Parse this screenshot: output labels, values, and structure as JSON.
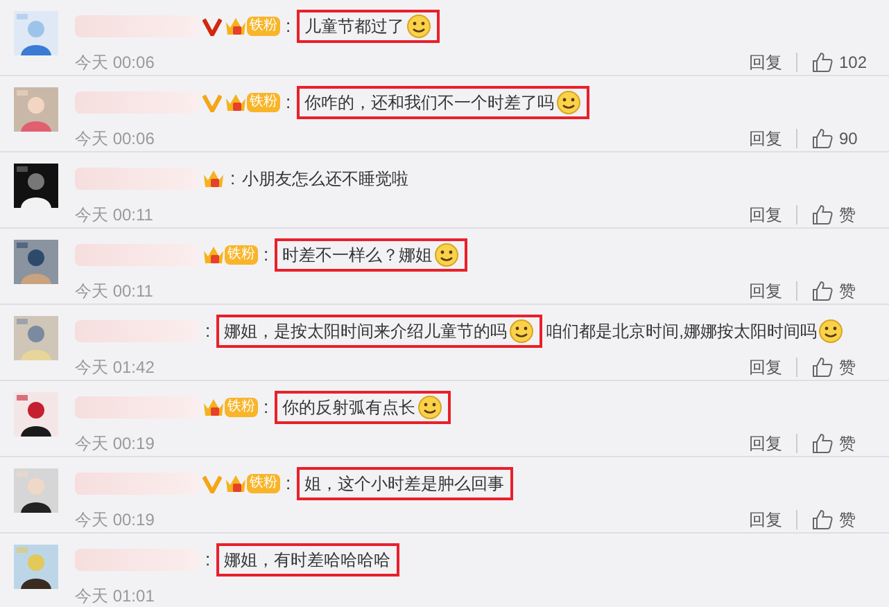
{
  "comments": [
    {
      "vip": {
        "color": "#d2280f"
      },
      "fan_badge": {
        "kind": "labeled",
        "label": "铁粉"
      },
      "separator": ":",
      "parts": [
        {
          "text": "儿童节都过了",
          "emoji": true,
          "boxed": true
        }
      ],
      "time": "今天 00:06",
      "reply": "回复",
      "likes": "102"
    },
    {
      "vip": {
        "color": "#f5a516"
      },
      "fan_badge": {
        "kind": "labeled",
        "label": "铁粉"
      },
      "separator": ":",
      "parts": [
        {
          "text": "你咋的，还和我们不一个时差了吗",
          "emoji": true,
          "boxed": true
        }
      ],
      "time": "今天 00:06",
      "reply": "回复",
      "likes": "90"
    },
    {
      "fan_badge": {
        "kind": "crown"
      },
      "separator": ":",
      "parts": [
        {
          "text": "小朋友怎么还不睡觉啦",
          "emoji": false,
          "boxed": false
        }
      ],
      "time": "今天 00:11",
      "reply": "回复",
      "likes": "赞"
    },
    {
      "fan_badge": {
        "kind": "labeled",
        "label": "铁粉"
      },
      "separator": ":",
      "parts": [
        {
          "text": "时差不一样么？娜姐",
          "emoji": true,
          "boxed": true
        }
      ],
      "time": "今天 00:11",
      "reply": "回复",
      "likes": "赞"
    },
    {
      "separator": ":",
      "parts": [
        {
          "text": "娜姐，是按太阳时间来介绍儿童节的吗",
          "emoji": true,
          "boxed": true
        },
        {
          "text": "咱们都是北京时间,娜娜按太阳时间吗",
          "emoji": true,
          "boxed": false
        }
      ],
      "time": "今天 01:42",
      "reply": "回复",
      "likes": "赞"
    },
    {
      "fan_badge": {
        "kind": "labeled",
        "label": "铁粉"
      },
      "separator": ":",
      "parts": [
        {
          "text": "你的反射弧有点长",
          "emoji": true,
          "boxed": true
        }
      ],
      "time": "今天 00:19",
      "reply": "回复",
      "likes": "赞"
    },
    {
      "vip": {
        "color": "#f5a516"
      },
      "fan_badge": {
        "kind": "labeled",
        "label": "铁粉"
      },
      "separator": ":",
      "parts": [
        {
          "text": "姐，这个小时差是肿么回事",
          "emoji": false,
          "boxed": true
        }
      ],
      "time": "今天 00:19",
      "reply": "回复",
      "likes": "赞"
    },
    {
      "separator": ":",
      "parts": [
        {
          "text": "娜姐，有时差哈哈哈哈",
          "emoji": false,
          "boxed": true
        }
      ],
      "time": "今天 01:01"
    }
  ]
}
